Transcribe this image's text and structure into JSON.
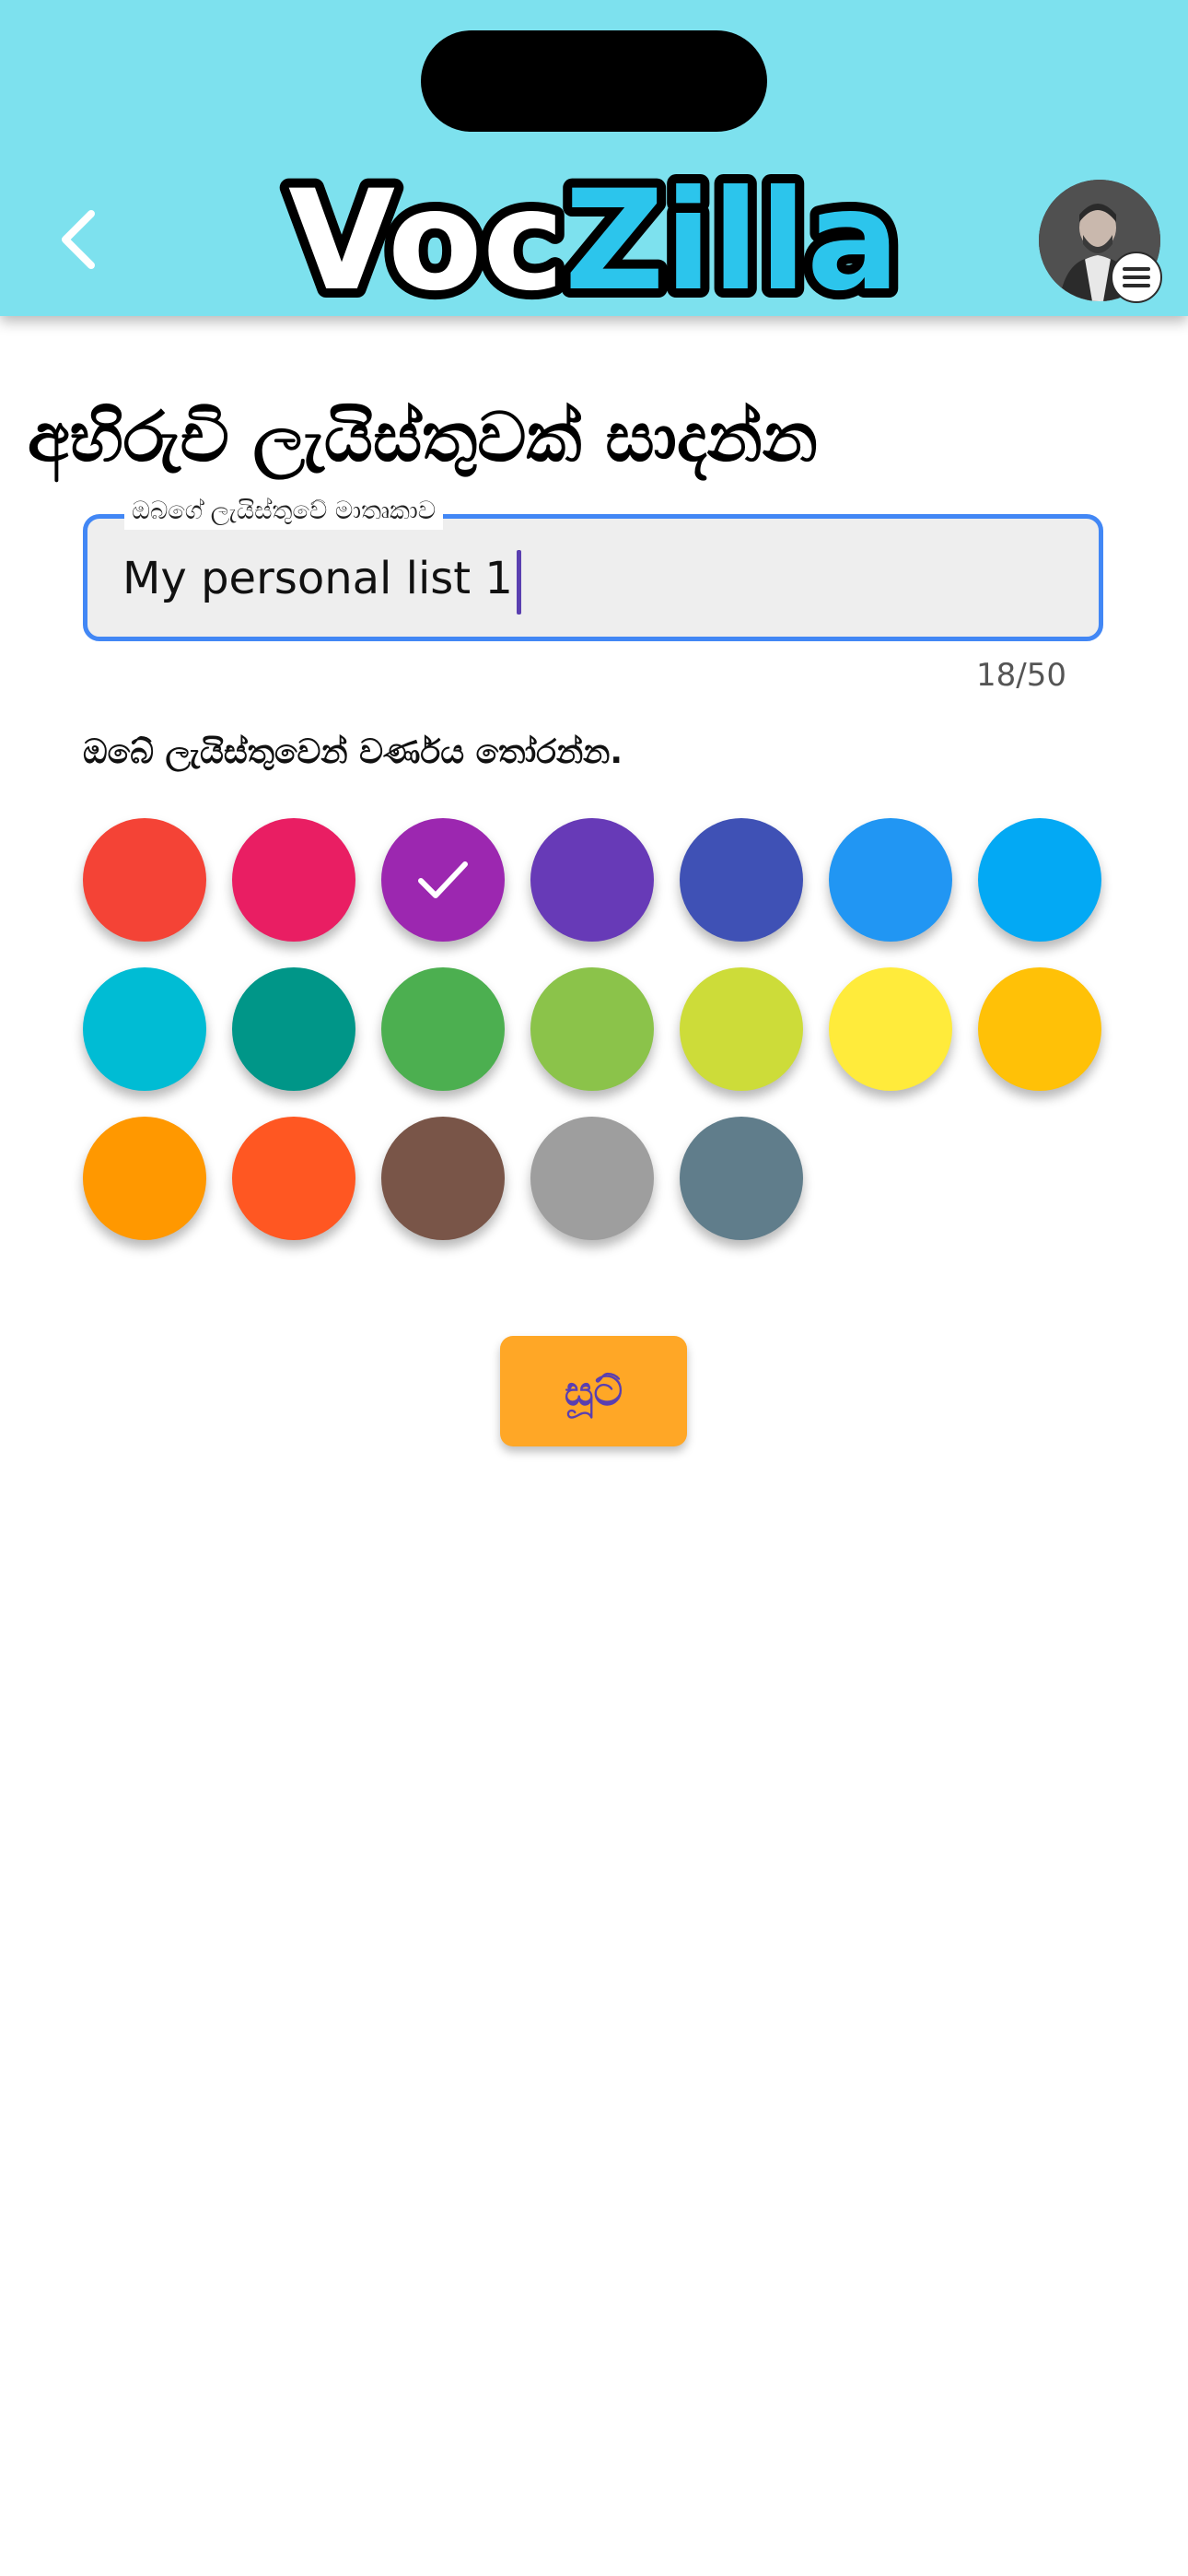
{
  "header": {
    "logo_part1": "Voc",
    "logo_part2": "Zilla",
    "logo_color1": "#ffffff",
    "logo_color2": "#2cc5ec",
    "background": "#7de1ee",
    "back_icon": "chevron-left-icon",
    "menu_icon": "hamburger-menu-icon"
  },
  "page": {
    "title": "අභිරුචි ලැයිස්තුවක් සාදන්න"
  },
  "name_field": {
    "label": "ඔබගේ ලැයිස්තුවේ මාතෘකාව",
    "value": "My personal list 1",
    "counter": "18/50"
  },
  "color_section": {
    "heading": "ඔබේ ලැයිස්තුවෙන් වර්ණය තෝරන්න.",
    "selected_index": 2,
    "colors": [
      "#f44336",
      "#e91e63",
      "#9c27b0",
      "#673ab7",
      "#3f51b5",
      "#2196f3",
      "#03a9f4",
      "#00bcd4",
      "#009688",
      "#4caf50",
      "#8bc34a",
      "#cddc39",
      "#ffeb3b",
      "#ffc107",
      "#ff9800",
      "#ff5722",
      "#795548",
      "#9e9e9e",
      "#607d8b"
    ]
  },
  "submit": {
    "label": "සූට්",
    "color": "#ffa726"
  }
}
